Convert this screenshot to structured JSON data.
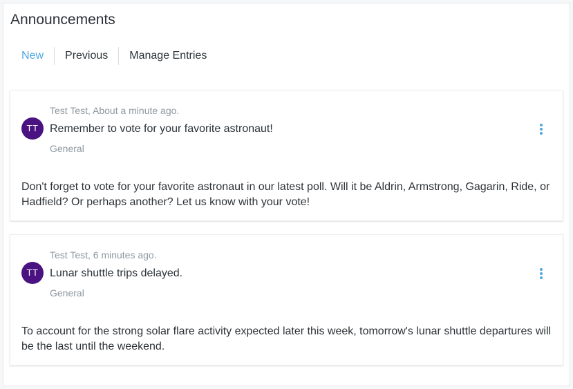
{
  "page": {
    "title": "Announcements"
  },
  "tabs": [
    {
      "label": "New",
      "active": true
    },
    {
      "label": "Previous",
      "active": false
    },
    {
      "label": "Manage Entries",
      "active": false
    }
  ],
  "announcements": [
    {
      "avatar": "TT",
      "meta": "Test Test, About a minute ago.",
      "title": "Remember to vote for your favorite astronaut!",
      "category": "General",
      "body": "Don't forget to vote for your favorite astronaut in our latest poll. Will it be Aldrin, Armstrong, Gagarin, Ride, or Hadfield? Or perhaps another? Let us know with your vote!"
    },
    {
      "avatar": "TT",
      "meta": "Test Test, 6 minutes ago.",
      "title": "Lunar shuttle trips delayed.",
      "category": "General",
      "body": "To account for the strong solar flare activity expected later this week, tomorrow's lunar shuttle departures will be the last until the weekend."
    }
  ],
  "colors": {
    "accent": "#4ea8de",
    "avatar": "#4b1281",
    "muted_text": "#8e979f"
  },
  "icons": {
    "menu": "kebab-menu-icon"
  }
}
